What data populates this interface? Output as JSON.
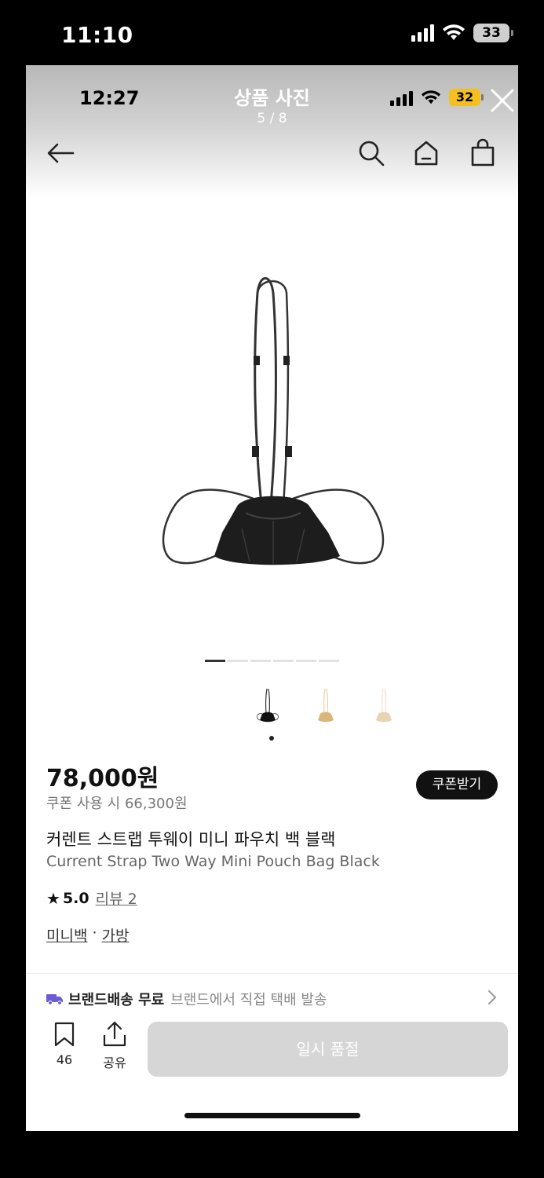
{
  "outer_status": {
    "time": "11:10",
    "battery": "33"
  },
  "inner_status": {
    "time": "12:27",
    "battery": "32"
  },
  "viewer": {
    "title": "상품 사진",
    "counter": "5 / 8"
  },
  "icons": {
    "back": "arrow-left-icon",
    "search": "search-icon",
    "home": "home-icon",
    "cart": "shopping-bag-icon",
    "close": "close-icon",
    "bookmark": "bookmark-icon",
    "share": "share-icon",
    "truck": "truck-icon",
    "chevron": "chevron-right-icon"
  },
  "carousel": {
    "total_dots": 6,
    "active_index": 0
  },
  "product": {
    "price": "78,000원",
    "coupon_price": "쿠폰 사용 시 66,300원",
    "coupon_button": "쿠폰받기",
    "name_ko": "커렌트 스트랩 투웨이 미니 파우치 백 블랙",
    "name_en": "Current Strap Two Way Mini Pouch Bag Black",
    "rating": "5.0",
    "review_link": "리뷰 2",
    "categories": [
      "미니백",
      "가방"
    ],
    "category_separator": "·"
  },
  "shipping": {
    "title": "브랜드배송 무료",
    "subtitle": "브랜드에서 직접 택배 발송"
  },
  "bottom_bar": {
    "save_count": "46",
    "share_label": "공유",
    "sold_out": "일시 품절"
  },
  "colors": {
    "accent_truck": "#6b5bd6",
    "price_text": "#111111",
    "soldout_bg": "#d6d6d6",
    "swatches": [
      "#111111",
      "#d9b77a",
      "#e8d3b3"
    ]
  }
}
